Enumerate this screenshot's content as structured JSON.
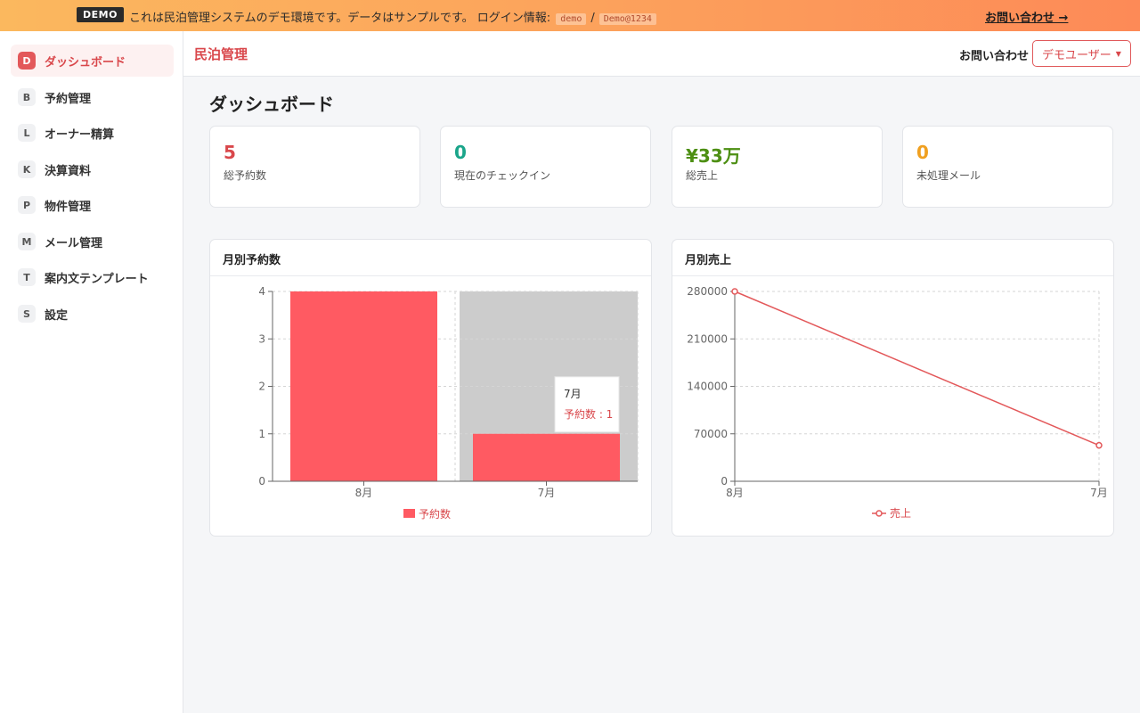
{
  "banner": {
    "badge": "DEMO",
    "message": "これは民泊管理システムのデモ環境です。データはサンプルです。 ログイン情報: ",
    "login_user": "demo",
    "separator": "/",
    "login_pass": "Demo@1234",
    "contact_link": "お問い合わせ →"
  },
  "sidebar": {
    "items": [
      {
        "key": "D",
        "label": "ダッシュボード",
        "active": true
      },
      {
        "key": "B",
        "label": "予約管理"
      },
      {
        "key": "L",
        "label": "オーナー精算"
      },
      {
        "key": "K",
        "label": "決算資料"
      },
      {
        "key": "P",
        "label": "物件管理"
      },
      {
        "key": "M",
        "label": "メール管理"
      },
      {
        "key": "T",
        "label": "案内文テンプレート"
      },
      {
        "key": "S",
        "label": "設定"
      }
    ]
  },
  "header": {
    "brand": "民泊管理",
    "contact": "お問い合わせ",
    "user_menu": "デモユーザー"
  },
  "page": {
    "title": "ダッシュボード"
  },
  "stats": [
    {
      "value": "5",
      "caption": "総予約数",
      "color": "#d9474b"
    },
    {
      "value": "0",
      "caption": "現在のチェックイン",
      "color": "#1aa58a"
    },
    {
      "value": "¥33万",
      "caption": "総売上",
      "color": "#4d8f13"
    },
    {
      "value": "0",
      "caption": "未処理メール",
      "color": "#f0a020"
    }
  ],
  "colors": {
    "accent": "#d9474b",
    "bar": "#ff5a62",
    "line": "#e3585a",
    "hover_band": "#cccccc"
  },
  "chart_data": [
    {
      "type": "bar",
      "title": "月別予約数",
      "categories": [
        "8月",
        "7月"
      ],
      "series": [
        {
          "name": "予約数",
          "values": [
            4,
            1
          ]
        }
      ],
      "ylim": [
        0,
        4
      ],
      "yticks": [
        0,
        1,
        2,
        3,
        4
      ],
      "grid": true,
      "legend": "bottom",
      "tooltip": {
        "category": "7月",
        "label": "予約数 : 1"
      }
    },
    {
      "type": "line",
      "title": "月別売上",
      "categories": [
        "8月",
        "7月"
      ],
      "series": [
        {
          "name": "売上",
          "values": [
            280000,
            53000
          ]
        }
      ],
      "ylim": [
        0,
        280000
      ],
      "yticks": [
        0,
        70000,
        140000,
        210000,
        280000
      ],
      "grid": true,
      "legend": "bottom"
    }
  ]
}
